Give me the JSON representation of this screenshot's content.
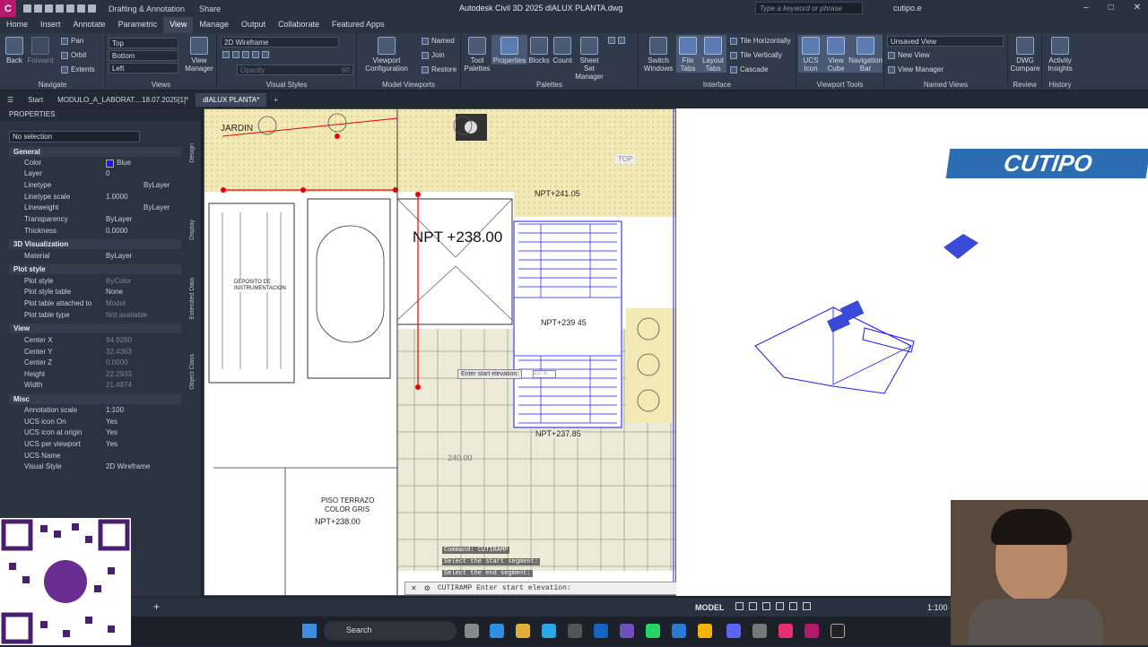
{
  "title_bar": {
    "app_letter": "C",
    "workspace": "Drafting & Annotation",
    "share": "Share",
    "window_title": "Autodesk Civil 3D 2025   dlALUX PLANTA.dwg",
    "search_placeholder": "Type a keyword or phrase",
    "user": "cutipo.e"
  },
  "menu": [
    "Home",
    "Insert",
    "Annotate",
    "Parametric",
    "View",
    "Manage",
    "Output",
    "Collaborate",
    "Featured Apps"
  ],
  "menu_active": "View",
  "ribbon": {
    "navigate": {
      "back": "Back",
      "forward": "Forward",
      "pan": "Pan",
      "orbit": "Orbit",
      "extents": "Extents",
      "label": "Navigate"
    },
    "views": {
      "items": [
        "Top",
        "Bottom",
        "Left"
      ],
      "view_manager": "View Manager",
      "label": "Views"
    },
    "visual_styles": {
      "current": "2D Wireframe",
      "label": "Visual Styles",
      "opacity": "Opacity",
      "opacity_value": "60"
    },
    "model_viewports": {
      "viewport_config": "Viewport Configuration",
      "named": "Named",
      "join": "Join",
      "restore": "Restore",
      "label": "Model Viewports"
    },
    "palettes": {
      "items": [
        "Tool Palettes",
        "Properties",
        "Blocks",
        "Count",
        "Sheet Set Manager"
      ],
      "label": "Palettes"
    },
    "interface": {
      "switch_windows": "Switch Windows",
      "file_tabs": "File Tabs",
      "layout_tabs": "Layout Tabs",
      "tile_h": "Tile Horizontally",
      "tile_v": "Tile Vertically",
      "cascade": "Cascade",
      "label": "Interface"
    },
    "viewport_tools": {
      "ucs_icon": "UCS Icon",
      "view_cube": "View Cube",
      "nav_bar": "Navigation Bar",
      "label": "Viewport Tools"
    },
    "named_views": {
      "unsaved": "Unsaved View",
      "new_view": "New View",
      "view_manager": "View Manager",
      "label": "Named Views"
    },
    "review": {
      "dwg_compare": "DWG Compare",
      "label": "Review"
    },
    "history": {
      "activity": "Activity Insights",
      "label": "History"
    }
  },
  "file_tabs": {
    "start": "Start",
    "tab1": "MODULO_A_LABORAT....18.07.2025[1]*",
    "tab2": "dlALUX PLANTA*"
  },
  "properties": {
    "header": "PROPERTIES",
    "selection": "No selection",
    "general": {
      "title": "General",
      "rows": [
        {
          "k": "Color",
          "v": "Blue"
        },
        {
          "k": "Layer",
          "v": "0"
        },
        {
          "k": "Linetype",
          "v": "ByLayer"
        },
        {
          "k": "Linetype scale",
          "v": "1.0000"
        },
        {
          "k": "Lineweight",
          "v": "ByLayer"
        },
        {
          "k": "Transparency",
          "v": "ByLayer"
        },
        {
          "k": "Thickness",
          "v": "0.0000"
        }
      ]
    },
    "viz": {
      "title": "3D Visualization",
      "rows": [
        {
          "k": "Material",
          "v": "ByLayer"
        }
      ]
    },
    "plot": {
      "title": "Plot style",
      "rows": [
        {
          "k": "Plot style",
          "v": "ByColor"
        },
        {
          "k": "Plot style table",
          "v": "None"
        },
        {
          "k": "Plot table attached to",
          "v": "Model"
        },
        {
          "k": "Plot table type",
          "v": "Not available"
        }
      ]
    },
    "view": {
      "title": "View",
      "rows": [
        {
          "k": "Center X",
          "v": "94.9280"
        },
        {
          "k": "Center Y",
          "v": "32.4363"
        },
        {
          "k": "Center Z",
          "v": "0.0000"
        },
        {
          "k": "Height",
          "v": "22.2933"
        },
        {
          "k": "Width",
          "v": "21.4874"
        }
      ]
    },
    "misc": {
      "title": "Misc",
      "rows": [
        {
          "k": "Annotation scale",
          "v": "1:100"
        },
        {
          "k": "UCS icon On",
          "v": "Yes"
        },
        {
          "k": "UCS icon at origin",
          "v": "Yes"
        },
        {
          "k": "UCS per viewport",
          "v": "Yes"
        },
        {
          "k": "UCS Name",
          "v": ""
        },
        {
          "k": "Visual Style",
          "v": "2D Wireframe"
        }
      ]
    },
    "side_tabs": [
      "Design",
      "Display",
      "Extended Data",
      "Object Class"
    ]
  },
  "drawing": {
    "jardin": "JARDIN",
    "npt_main": "NPT +238.00",
    "npt1": "NPT+241.05",
    "npt2": "NPT+239 45",
    "npt3": "NPT+237.85",
    "terrazo1": "PISO TERRAZO",
    "terrazo2": "COLOR GRIS",
    "npt4": "NPT+238.00",
    "deposito": "DEPOSITO DE INSTRUMENTACION",
    "val240": "240.00",
    "top": "TOP",
    "tooltip": "Enter start elevation:",
    "tip_value": "237.8",
    "hist1": "Command: CUTIRAMP",
    "hist2": "Select the start segment:",
    "hist3": "Select the end segment:",
    "cmd": "CUTIRAMP Enter start elevation:"
  },
  "right_logo": "CUTIPO",
  "status": {
    "model": "MODEL",
    "scale": "1:100"
  },
  "taskbar": {
    "search": "Search"
  }
}
